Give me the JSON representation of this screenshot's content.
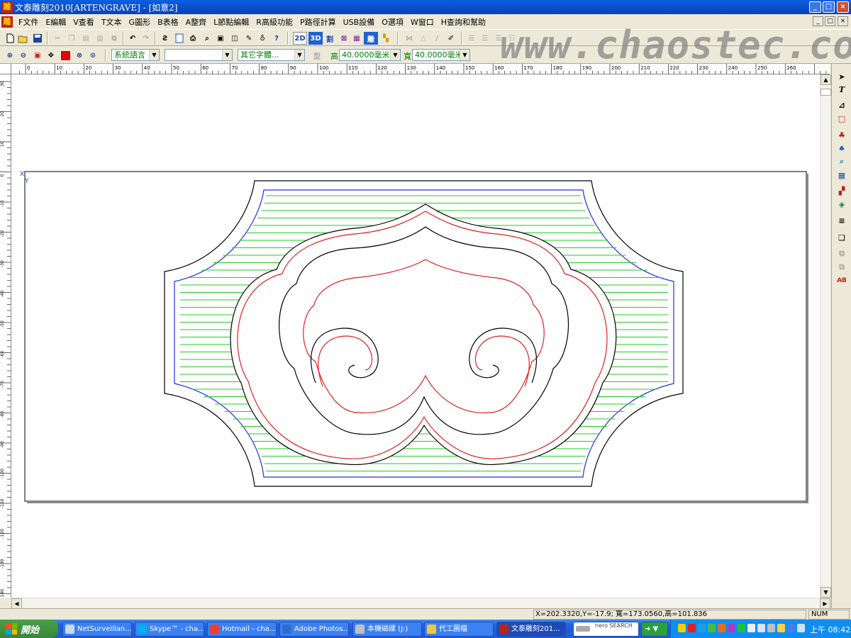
{
  "window": {
    "title": "文泰雕刻2010[ARTENGRAVE] - [如意2]",
    "app_icon_glyph": "雕",
    "minimize": "_",
    "maximize": "□",
    "close": "×"
  },
  "menu": {
    "items": [
      "F文件",
      "E編輯",
      "V查看",
      "T文本",
      "G圖形",
      "B表格",
      "A整齊",
      "L節點編輯",
      "R高級功能",
      "P路徑計算",
      "USB設備",
      "O選項",
      "W窗口",
      "H查詢和幫助"
    ]
  },
  "toolbar1": {
    "buttons": [
      "new",
      "open",
      "save",
      "cut",
      "copy",
      "paste",
      "paste-special",
      "clone",
      "undo",
      "redo",
      "path",
      "page-setup",
      "print",
      "print-preview",
      "frame",
      "eyedropper",
      "light",
      "help"
    ],
    "mode_2d": "2D",
    "mode_3d": "3D",
    "mode_cut": "割",
    "mode_engrave": "雕"
  },
  "toolbar2": {
    "language_combo": "系統語言",
    "font_combo": "",
    "font2_combo": "其它字體...",
    "height_label": "高",
    "height_value": "40.0000毫米",
    "width_label": "寬",
    "width_value": "40.0000毫米"
  },
  "ruler": {
    "h_labels": [
      "0",
      "10",
      "20",
      "30",
      "40",
      "50",
      "60",
      "70",
      "80",
      "90",
      "100",
      "110",
      "120",
      "130",
      "140",
      "150",
      "160",
      "170",
      "180",
      "190",
      "200",
      "210",
      "220",
      "230",
      "240",
      "250",
      "260"
    ],
    "v_labels": [
      "30",
      "20",
      "10",
      "0",
      "-10",
      "-20",
      "-30",
      "-40",
      "-50",
      "-60",
      "-70",
      "-80",
      "-90",
      "-100",
      "-110",
      "-120",
      "-130",
      "-140"
    ]
  },
  "canvas": {
    "origin_label_x": "X",
    "origin_label_y": "Y"
  },
  "watermark": "www.chaostec.com",
  "status": {
    "coords": "X=202.3320,Y=-17.9; 寬=173.0560,高=101.836",
    "num": "NUM"
  },
  "taskbar": {
    "start": "開始",
    "tasks": [
      {
        "label": "NetSurveillan...",
        "color": "#c8d8f0"
      },
      {
        "label": "Skype™ - cha...",
        "color": "#00aff0"
      },
      {
        "label": "Hotmail - cha...",
        "color": "#e94235"
      },
      {
        "label": "Adobe Photos...",
        "color": "#2a6fd0"
      },
      {
        "label": "本機磁碟 (J:)",
        "color": "#c0c0c0"
      },
      {
        "label": "代工圖檔",
        "color": "#f0c840"
      },
      {
        "label": "文泰雕刻201...",
        "color": "#c02010"
      }
    ],
    "search_brand": "nero SEARCH",
    "clock": "上午 08:42"
  },
  "colors": {
    "boundary": "#000000",
    "fill_path": "#22cc22",
    "outline_red": "#e02020",
    "outline_blue": "#2030e0"
  }
}
